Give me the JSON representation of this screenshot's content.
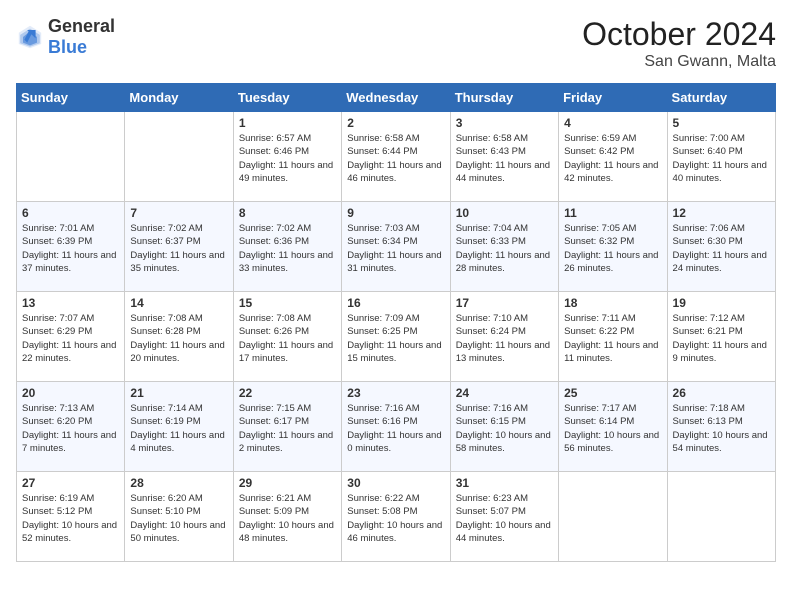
{
  "header": {
    "logo_general": "General",
    "logo_blue": "Blue",
    "title": "October 2024",
    "location": "San Gwann, Malta"
  },
  "days_of_week": [
    "Sunday",
    "Monday",
    "Tuesday",
    "Wednesday",
    "Thursday",
    "Friday",
    "Saturday"
  ],
  "weeks": [
    [
      {
        "day": "",
        "info": ""
      },
      {
        "day": "",
        "info": ""
      },
      {
        "day": "1",
        "info": "Sunrise: 6:57 AM\nSunset: 6:46 PM\nDaylight: 11 hours and 49 minutes."
      },
      {
        "day": "2",
        "info": "Sunrise: 6:58 AM\nSunset: 6:44 PM\nDaylight: 11 hours and 46 minutes."
      },
      {
        "day": "3",
        "info": "Sunrise: 6:58 AM\nSunset: 6:43 PM\nDaylight: 11 hours and 44 minutes."
      },
      {
        "day": "4",
        "info": "Sunrise: 6:59 AM\nSunset: 6:42 PM\nDaylight: 11 hours and 42 minutes."
      },
      {
        "day": "5",
        "info": "Sunrise: 7:00 AM\nSunset: 6:40 PM\nDaylight: 11 hours and 40 minutes."
      }
    ],
    [
      {
        "day": "6",
        "info": "Sunrise: 7:01 AM\nSunset: 6:39 PM\nDaylight: 11 hours and 37 minutes."
      },
      {
        "day": "7",
        "info": "Sunrise: 7:02 AM\nSunset: 6:37 PM\nDaylight: 11 hours and 35 minutes."
      },
      {
        "day": "8",
        "info": "Sunrise: 7:02 AM\nSunset: 6:36 PM\nDaylight: 11 hours and 33 minutes."
      },
      {
        "day": "9",
        "info": "Sunrise: 7:03 AM\nSunset: 6:34 PM\nDaylight: 11 hours and 31 minutes."
      },
      {
        "day": "10",
        "info": "Sunrise: 7:04 AM\nSunset: 6:33 PM\nDaylight: 11 hours and 28 minutes."
      },
      {
        "day": "11",
        "info": "Sunrise: 7:05 AM\nSunset: 6:32 PM\nDaylight: 11 hours and 26 minutes."
      },
      {
        "day": "12",
        "info": "Sunrise: 7:06 AM\nSunset: 6:30 PM\nDaylight: 11 hours and 24 minutes."
      }
    ],
    [
      {
        "day": "13",
        "info": "Sunrise: 7:07 AM\nSunset: 6:29 PM\nDaylight: 11 hours and 22 minutes."
      },
      {
        "day": "14",
        "info": "Sunrise: 7:08 AM\nSunset: 6:28 PM\nDaylight: 11 hours and 20 minutes."
      },
      {
        "day": "15",
        "info": "Sunrise: 7:08 AM\nSunset: 6:26 PM\nDaylight: 11 hours and 17 minutes."
      },
      {
        "day": "16",
        "info": "Sunrise: 7:09 AM\nSunset: 6:25 PM\nDaylight: 11 hours and 15 minutes."
      },
      {
        "day": "17",
        "info": "Sunrise: 7:10 AM\nSunset: 6:24 PM\nDaylight: 11 hours and 13 minutes."
      },
      {
        "day": "18",
        "info": "Sunrise: 7:11 AM\nSunset: 6:22 PM\nDaylight: 11 hours and 11 minutes."
      },
      {
        "day": "19",
        "info": "Sunrise: 7:12 AM\nSunset: 6:21 PM\nDaylight: 11 hours and 9 minutes."
      }
    ],
    [
      {
        "day": "20",
        "info": "Sunrise: 7:13 AM\nSunset: 6:20 PM\nDaylight: 11 hours and 7 minutes."
      },
      {
        "day": "21",
        "info": "Sunrise: 7:14 AM\nSunset: 6:19 PM\nDaylight: 11 hours and 4 minutes."
      },
      {
        "day": "22",
        "info": "Sunrise: 7:15 AM\nSunset: 6:17 PM\nDaylight: 11 hours and 2 minutes."
      },
      {
        "day": "23",
        "info": "Sunrise: 7:16 AM\nSunset: 6:16 PM\nDaylight: 11 hours and 0 minutes."
      },
      {
        "day": "24",
        "info": "Sunrise: 7:16 AM\nSunset: 6:15 PM\nDaylight: 10 hours and 58 minutes."
      },
      {
        "day": "25",
        "info": "Sunrise: 7:17 AM\nSunset: 6:14 PM\nDaylight: 10 hours and 56 minutes."
      },
      {
        "day": "26",
        "info": "Sunrise: 7:18 AM\nSunset: 6:13 PM\nDaylight: 10 hours and 54 minutes."
      }
    ],
    [
      {
        "day": "27",
        "info": "Sunrise: 6:19 AM\nSunset: 5:12 PM\nDaylight: 10 hours and 52 minutes."
      },
      {
        "day": "28",
        "info": "Sunrise: 6:20 AM\nSunset: 5:10 PM\nDaylight: 10 hours and 50 minutes."
      },
      {
        "day": "29",
        "info": "Sunrise: 6:21 AM\nSunset: 5:09 PM\nDaylight: 10 hours and 48 minutes."
      },
      {
        "day": "30",
        "info": "Sunrise: 6:22 AM\nSunset: 5:08 PM\nDaylight: 10 hours and 46 minutes."
      },
      {
        "day": "31",
        "info": "Sunrise: 6:23 AM\nSunset: 5:07 PM\nDaylight: 10 hours and 44 minutes."
      },
      {
        "day": "",
        "info": ""
      },
      {
        "day": "",
        "info": ""
      }
    ]
  ]
}
